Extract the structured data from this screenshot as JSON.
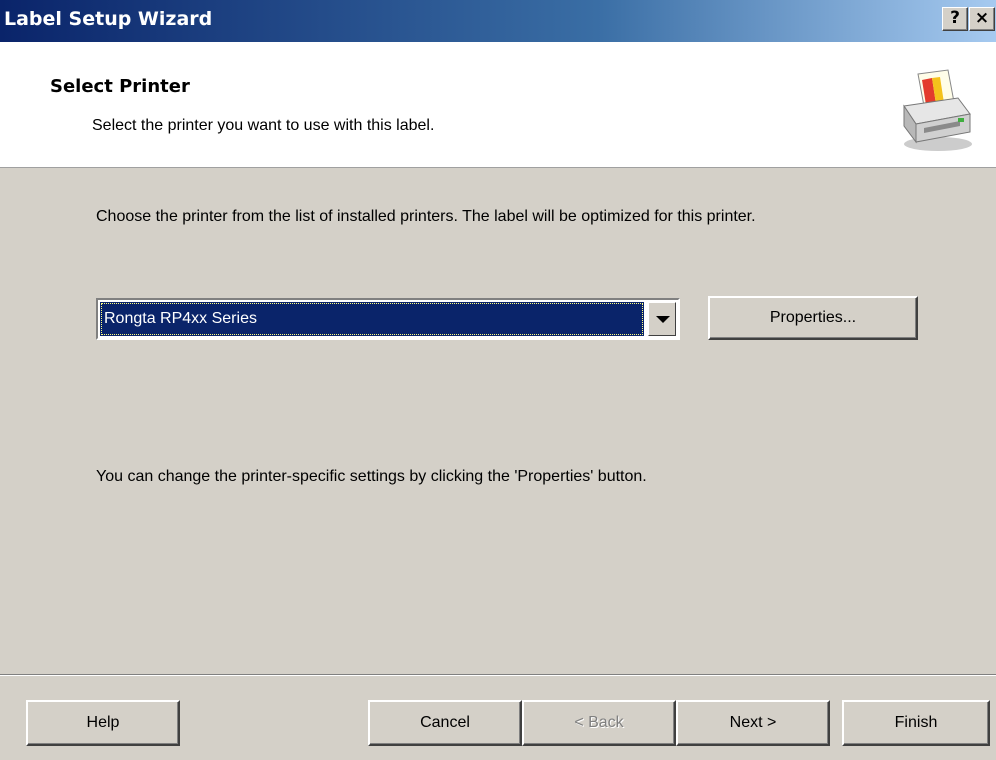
{
  "window": {
    "title": "Label Setup Wizard",
    "help_button": "?",
    "close_button": "×"
  },
  "header": {
    "title": "Select Printer",
    "subtitle": "Select the printer you want to use with this label.",
    "icon": "printer-icon"
  },
  "body": {
    "instruction": "Choose the printer from the list of installed printers. The label will be optimized for this printer.",
    "printer_select": {
      "selected": "Rongta RP4xx Series"
    },
    "properties_button": "Properties...",
    "note": "You can change the printer-specific settings by clicking the 'Properties' button."
  },
  "footer": {
    "help": "Help",
    "cancel": "Cancel",
    "back": "< Back",
    "next": "Next >",
    "finish": "Finish",
    "back_disabled": true
  },
  "colors": {
    "dialog_bg": "#d4d0c8",
    "title_gradient_start": "#0a246a",
    "title_gradient_end": "#a6caf0",
    "selection_bg": "#0a246a"
  }
}
